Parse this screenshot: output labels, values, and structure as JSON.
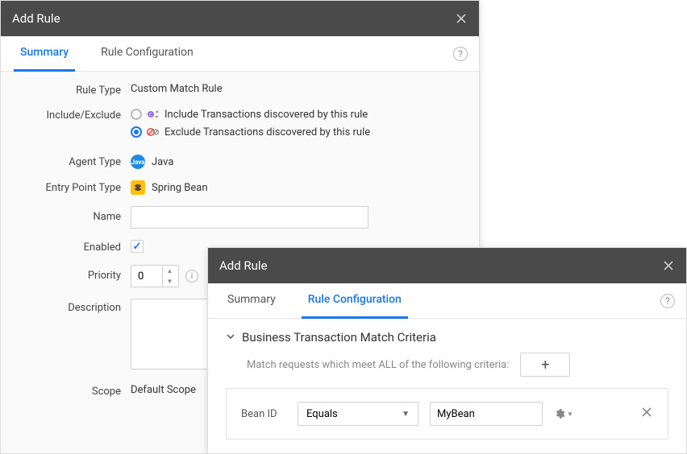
{
  "dialog1": {
    "title": "Add Rule",
    "tabs": {
      "summary": "Summary",
      "config": "Rule Configuration"
    },
    "form": {
      "rule_type_label": "Rule Type",
      "rule_type_value": "Custom Match Rule",
      "include_exclude_label": "Include/Exclude",
      "include_text": "Include Transactions discovered by this rule",
      "exclude_text": "Exclude Transactions discovered by this rule",
      "agent_type_label": "Agent Type",
      "agent_type_value": "Java",
      "agent_badge": "Java",
      "entry_point_label": "Entry Point Type",
      "entry_point_value": "Spring Bean",
      "name_label": "Name",
      "name_value": "",
      "enabled_label": "Enabled",
      "priority_label": "Priority",
      "priority_value": "0",
      "description_label": "Description",
      "description_value": "",
      "scope_label": "Scope",
      "scope_value": "Default Scope"
    }
  },
  "dialog2": {
    "title": "Add Rule",
    "tabs": {
      "summary": "Summary",
      "config": "Rule Configuration"
    },
    "section_title": "Business Transaction Match Criteria",
    "subtext": "Match requests which meet ALL of the following criteria:",
    "criteria": {
      "label": "Bean ID",
      "operator": "Equals",
      "value": "MyBean"
    }
  }
}
